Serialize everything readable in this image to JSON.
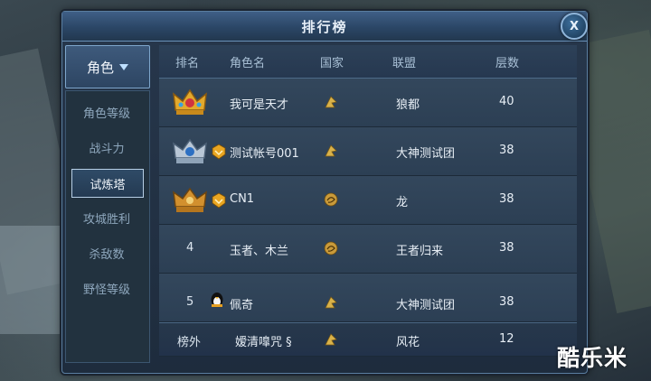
{
  "window": {
    "title": "排行榜",
    "close_label": "X"
  },
  "sidebar": {
    "dropdown_label": "角色",
    "items": [
      "角色等级",
      "战斗力",
      "试炼塔",
      "攻城胜利",
      "杀敌数",
      "野怪等级"
    ],
    "active_index": 2
  },
  "table": {
    "headers": [
      "排名",
      "角色名",
      "国家",
      "联盟",
      "层数"
    ],
    "rows": [
      {
        "rank": "",
        "rank_icon": "gold-crown-icon",
        "badge": "",
        "name": "我可是天才",
        "country_icon": "country-flag-icon",
        "alliance": "狼都",
        "floors": "40"
      },
      {
        "rank": "",
        "rank_icon": "silver-crown-icon",
        "badge": "vip-badge-icon",
        "name": "测试帐号001",
        "country_icon": "country-flag-icon",
        "alliance": "大神测试团",
        "floors": "38"
      },
      {
        "rank": "",
        "rank_icon": "bronze-crown-icon",
        "badge": "vip-badge-icon",
        "name": "CN1",
        "country_icon": "dragon-emblem-icon",
        "alliance": "龙",
        "floors": "38"
      },
      {
        "rank": "4",
        "rank_icon": "",
        "badge": "",
        "name": "玉者、木兰",
        "country_icon": "dragon-emblem-icon",
        "alliance": "王者归来",
        "floors": "38"
      },
      {
        "rank": "5",
        "rank_icon": "",
        "badge": "penguin-badge-icon",
        "name": "佩奇",
        "country_icon": "country-flag-icon",
        "alliance": "大神测试团",
        "floors": "38"
      }
    ],
    "self_row": {
      "rank": "榜外",
      "name": "嫒清嘷咒 §",
      "country_icon": "country-flag-icon",
      "alliance": "风花",
      "floors": "12"
    }
  },
  "watermark": "酷乐米",
  "colors": {
    "panel": "#1e2c3d",
    "row": "#33475c",
    "accent_border": "#7ea6cc",
    "text": "#e7eef5"
  }
}
